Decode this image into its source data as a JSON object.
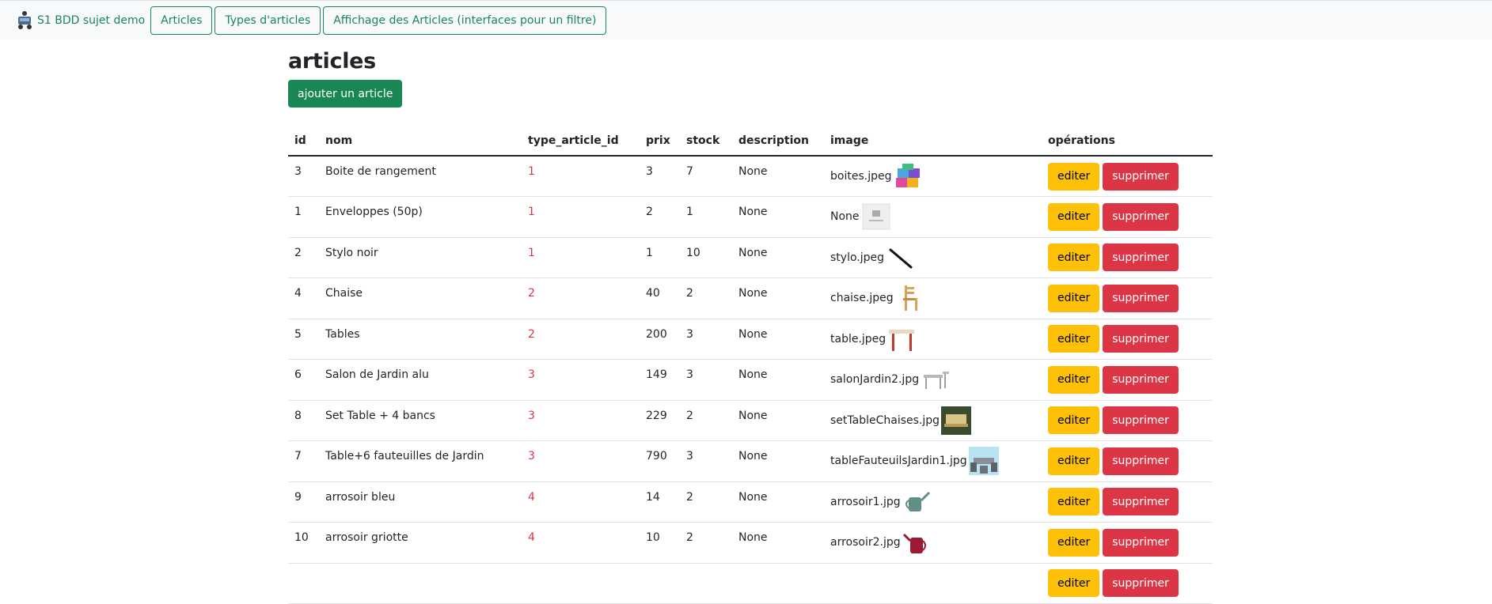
{
  "nav": {
    "brand": "S1 BDD sujet demo",
    "links": [
      "Articles",
      "Types d'articles",
      "Affichage des Articles (interfaces pour un filtre)"
    ]
  },
  "page": {
    "title": "articles",
    "add_button": "ajouter un article"
  },
  "table": {
    "headers": [
      "id",
      "nom",
      "type_article_id",
      "prix",
      "stock",
      "description",
      "image",
      "opérations"
    ],
    "edit_label": "editer",
    "delete_label": "supprimer",
    "rows": [
      {
        "id": "3",
        "nom": "Boite de rangement",
        "type": "1",
        "prix": "3",
        "stock": "7",
        "description": "None",
        "image": "boites.jpeg",
        "thumb": "storage-boxes-icon"
      },
      {
        "id": "1",
        "nom": "Enveloppes (50p)",
        "type": "1",
        "prix": "2",
        "stock": "1",
        "description": "None",
        "image": "None",
        "thumb": "no-image-icon"
      },
      {
        "id": "2",
        "nom": "Stylo noir",
        "type": "1",
        "prix": "1",
        "stock": "10",
        "description": "None",
        "image": "stylo.jpeg",
        "thumb": "pen-icon"
      },
      {
        "id": "4",
        "nom": "Chaise",
        "type": "2",
        "prix": "40",
        "stock": "2",
        "description": "None",
        "image": "chaise.jpeg",
        "thumb": "chair-icon"
      },
      {
        "id": "5",
        "nom": "Tables",
        "type": "2",
        "prix": "200",
        "stock": "3",
        "description": "None",
        "image": "table.jpeg",
        "thumb": "table-icon"
      },
      {
        "id": "6",
        "nom": "Salon de Jardin alu",
        "type": "3",
        "prix": "149",
        "stock": "3",
        "description": "None",
        "image": "salonJardin2.jpg",
        "thumb": "garden-set-icon"
      },
      {
        "id": "8",
        "nom": "Set Table + 4 bancs",
        "type": "3",
        "prix": "229",
        "stock": "2",
        "description": "None",
        "image": "setTableChaises.jpg",
        "thumb": "table-benches-icon"
      },
      {
        "id": "7",
        "nom": "Table+6 fauteuilles de Jardin",
        "type": "3",
        "prix": "790",
        "stock": "3",
        "description": "None",
        "image": "tableFauteuilsJardin1.jpg",
        "thumb": "garden-table-armchairs-icon"
      },
      {
        "id": "9",
        "nom": "arrosoir bleu",
        "type": "4",
        "prix": "14",
        "stock": "2",
        "description": "None",
        "image": "arrosoir1.jpg",
        "thumb": "watering-can-icon"
      },
      {
        "id": "10",
        "nom": "arrosoir griotte",
        "type": "4",
        "prix": "10",
        "stock": "2",
        "description": "None",
        "image": "arrosoir2.jpg",
        "thumb": "watering-can-red-icon"
      },
      {
        "id": "",
        "nom": "",
        "type": "",
        "prix": "",
        "stock": "",
        "description": "",
        "image": "",
        "thumb": "partial-row"
      }
    ]
  },
  "colors": {
    "brand": "#198754",
    "warning": "#ffc107",
    "danger": "#dc3545"
  }
}
